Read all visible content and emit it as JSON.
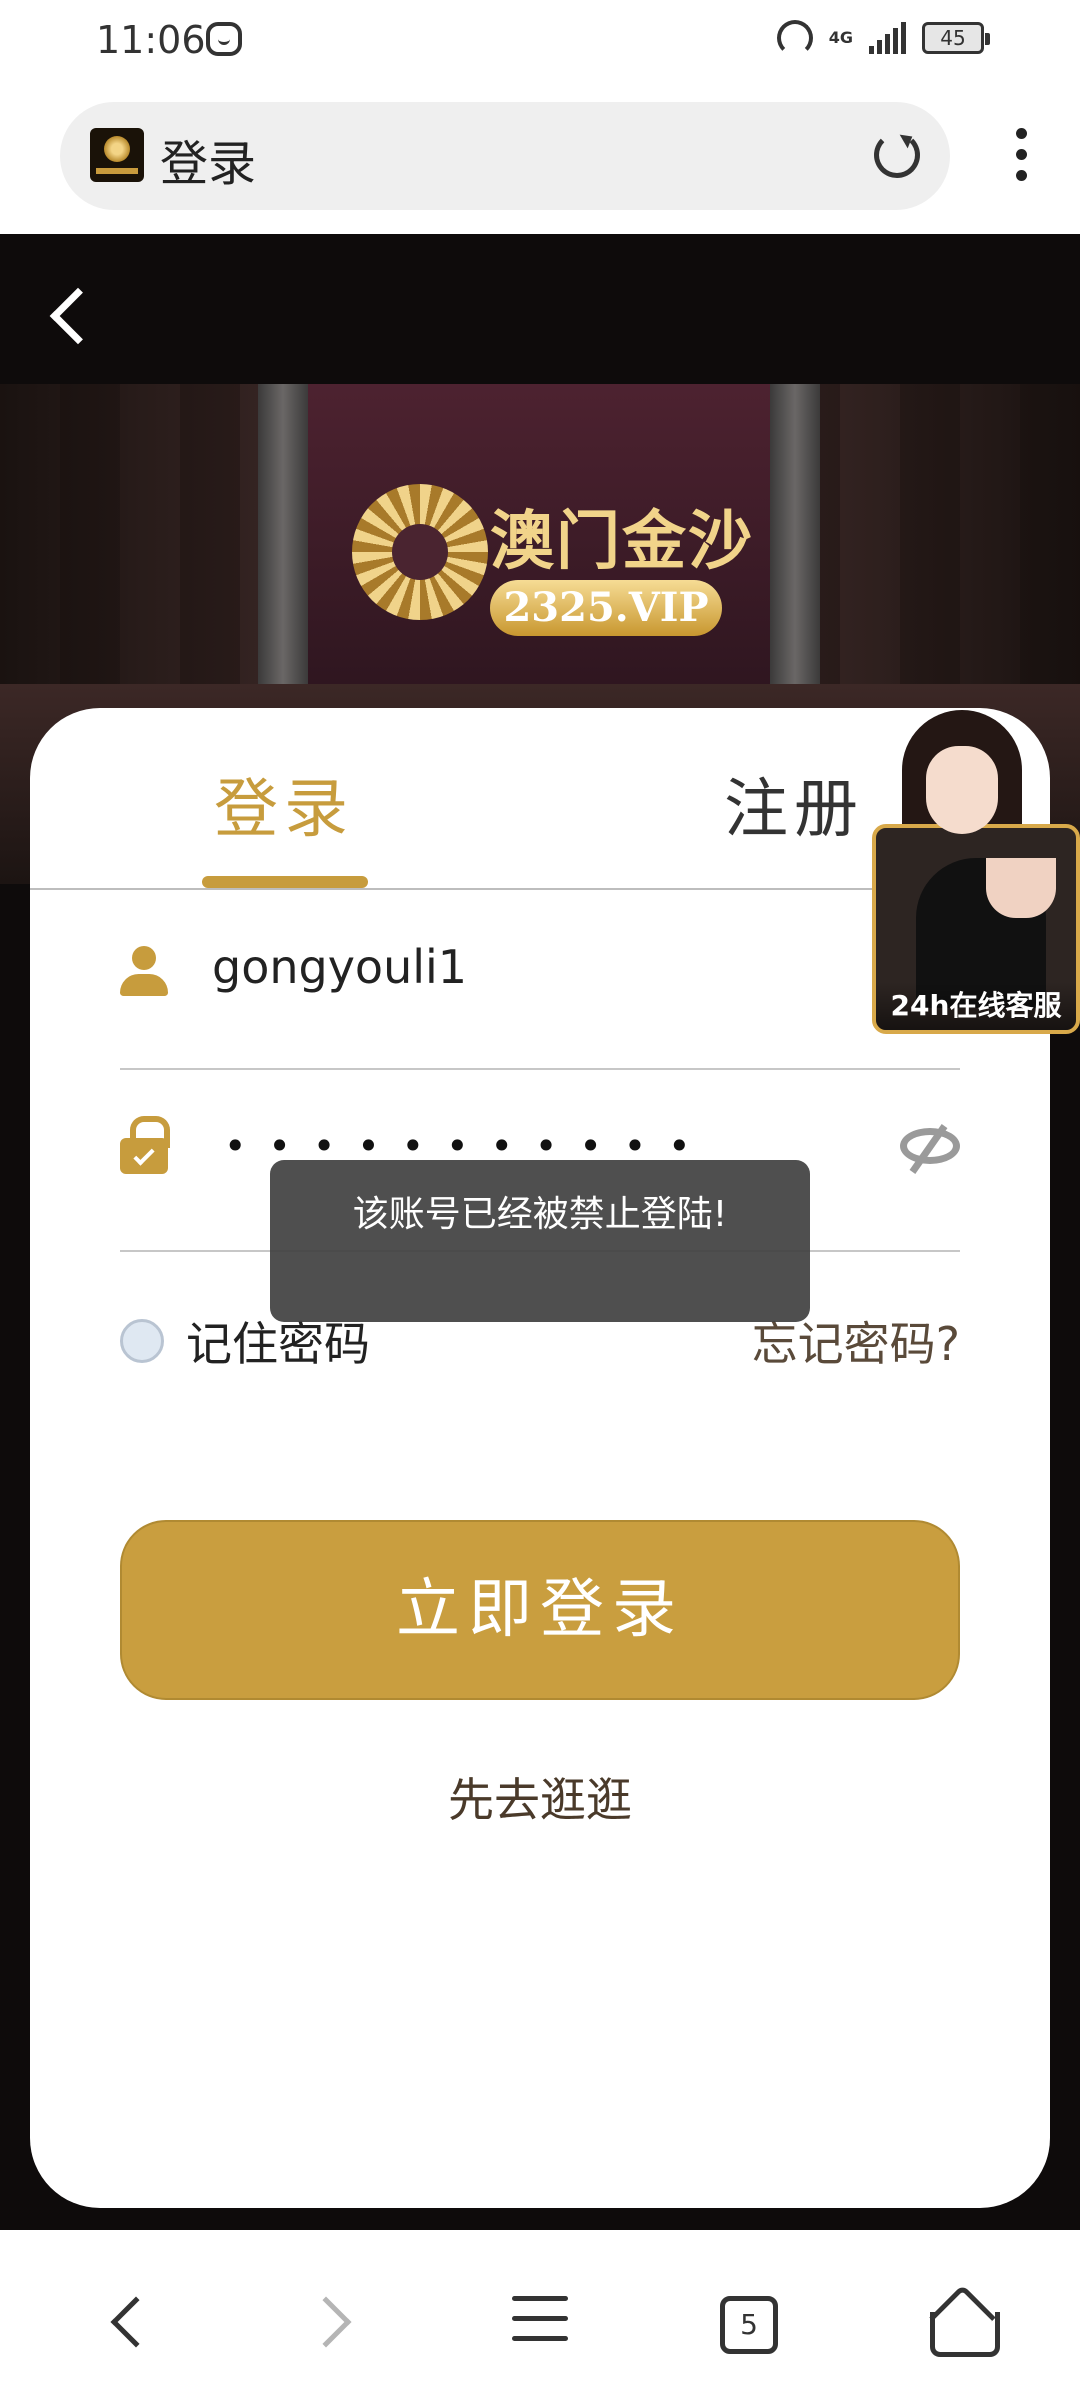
{
  "status_bar": {
    "time": "11:06",
    "network": "4G",
    "battery": "45"
  },
  "address_bar": {
    "title": "登录"
  },
  "hero": {
    "brand_name": "澳门金沙",
    "brand_vip": "2325.VIP"
  },
  "login_card": {
    "tabs": [
      {
        "label": "登录",
        "active": true
      },
      {
        "label": "注册",
        "active": false
      }
    ],
    "username": {
      "value": "gongyouli1"
    },
    "password": {
      "masked": "•••••••••••"
    },
    "remember_label": "记住密码",
    "forgot_label": "忘记密码?",
    "login_button": "立即登录",
    "browse_link": "先去逛逛"
  },
  "customer_service": {
    "label": "24h在线客服"
  },
  "toast": {
    "message": "该账号已经被禁止登陆!"
  },
  "bottom_bar": {
    "tab_count": "5"
  },
  "colors": {
    "accent_gold": "#c79c3d",
    "button_gold": "#c99e3f",
    "page_dark": "#0e0b0b",
    "toast_bg": "#404040"
  }
}
